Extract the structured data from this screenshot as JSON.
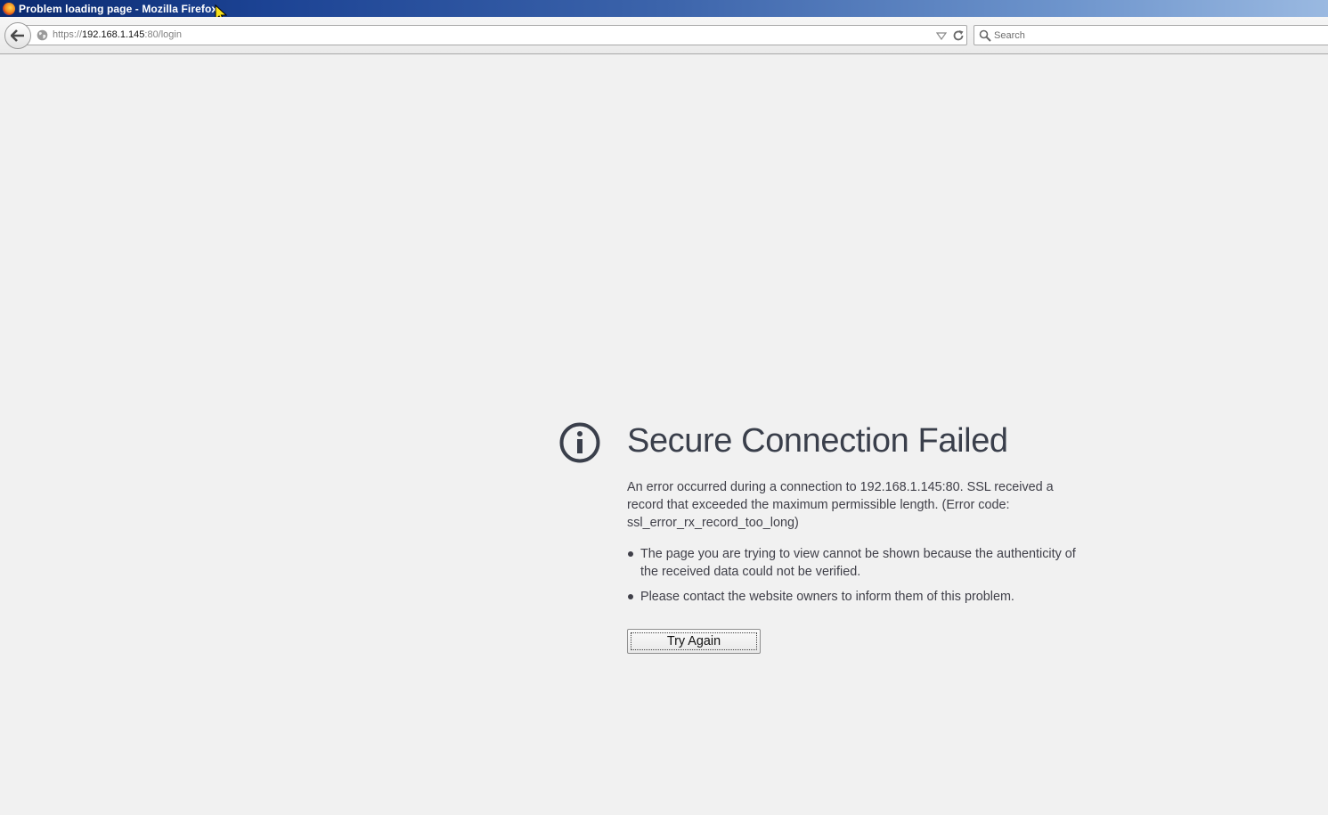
{
  "window": {
    "title": "Problem loading page - Mozilla Firefox"
  },
  "navbar": {
    "url_scheme": "https://",
    "url_host": "192.168.1.145",
    "url_rest": ":80/login",
    "search_placeholder": "Search"
  },
  "error": {
    "title": "Secure Connection Failed",
    "description": "An error occurred during a connection to 192.168.1.145:80. SSL received a record that exceeded the maximum permissible length. (Error code: ssl_error_rx_record_too_long)",
    "bullets": [
      "The page you are trying to view cannot be shown because the authenticity of the received data could not be verified.",
      "Please contact the website owners to inform them of this problem."
    ],
    "button_label": "Try Again"
  },
  "icons": {
    "app": "firefox-logo-icon",
    "back": "back-arrow-icon",
    "site": "globe-icon",
    "dropdown": "history-dropdown-icon",
    "reload": "reload-icon",
    "search": "search-icon",
    "error": "info-icon"
  },
  "colors": {
    "page_background": "#f1f1f1",
    "title_text": "#3a3f4b",
    "body_text": "#3f3f48",
    "titlebar_start": "#0b2a6f",
    "titlebar_end": "#9ab9e1"
  }
}
